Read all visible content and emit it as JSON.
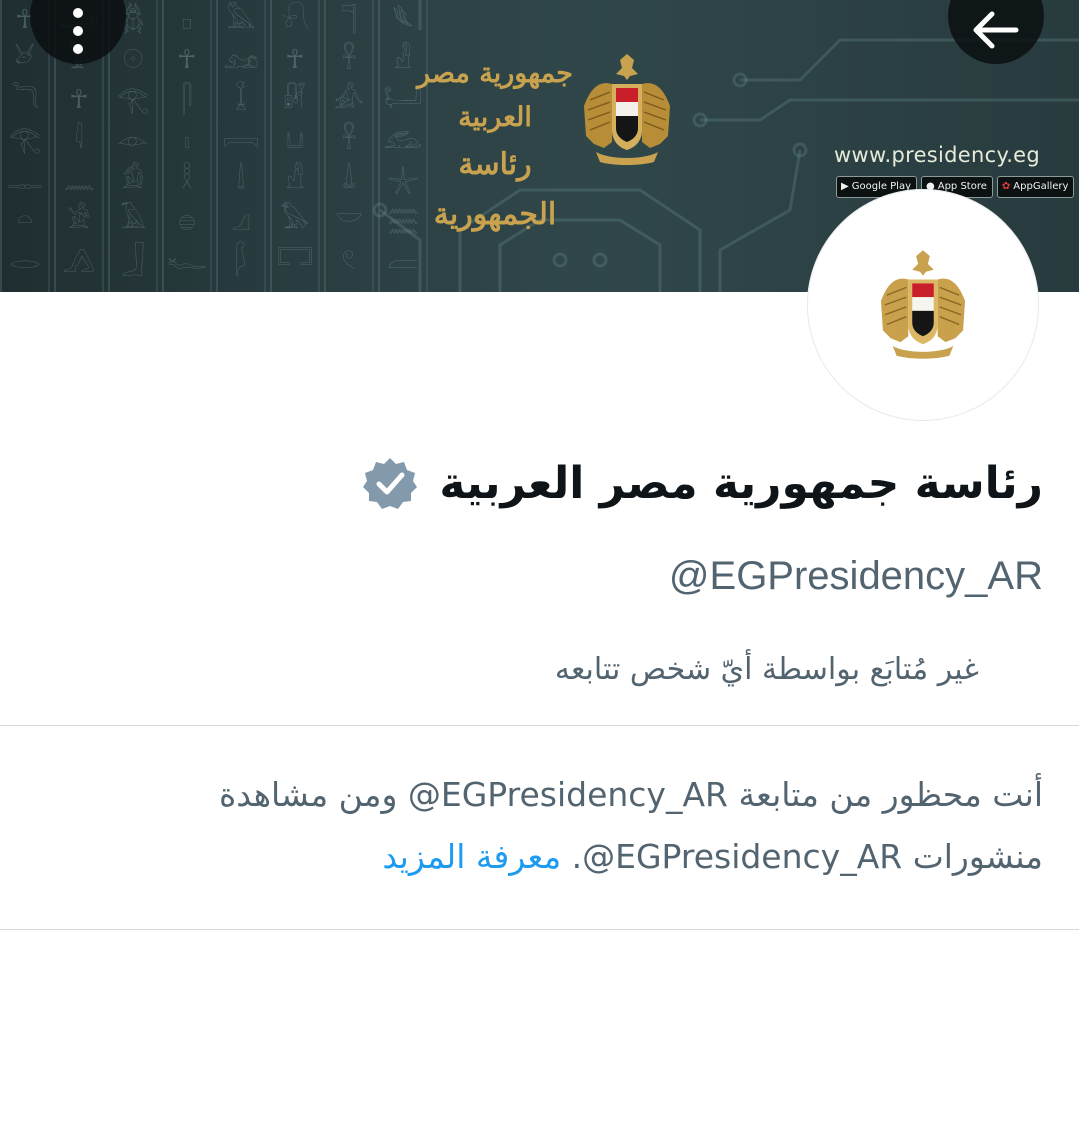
{
  "banner": {
    "calligraphy_line1": "جمهورية مصر العربية",
    "calligraphy_line2": "رئاسة الجمهورية",
    "website": "www.presidency.eg",
    "store_badges": [
      "Google Play",
      "App Store",
      "AppGallery"
    ],
    "hieroglyphs": [
      "☥",
      "𓂀",
      "☥",
      "𓆣",
      "☥",
      "𓅓",
      "☥",
      "𓋹"
    ]
  },
  "toolbar": {
    "more_icon": "more-vertical-icon",
    "back_icon": "arrow-left-icon"
  },
  "profile": {
    "display_name": "رئاسة جمهورية مصر العربية",
    "verified_badge": "verified-badge-icon",
    "handle": "@EGPresidency_AR",
    "follow_context": "غير مُتابَع بواسطة أيّ شخص تتابعه"
  },
  "blocked": {
    "part1": "أنت محظور من متابعة ",
    "handle1": "EGPresidency_AR@",
    "part2": " ومن مشاهدة منشورات ",
    "handle2": "EGPresidency_AR@",
    "part3": ". ",
    "learn_more": "معرفة المزيد"
  },
  "colors": {
    "text_primary": "#0f1419",
    "text_secondary": "#536471",
    "link": "#1d9bf0",
    "verified_badge": "#829aab",
    "banner_dark": "#2c4043",
    "gold": "#c8a24e"
  }
}
